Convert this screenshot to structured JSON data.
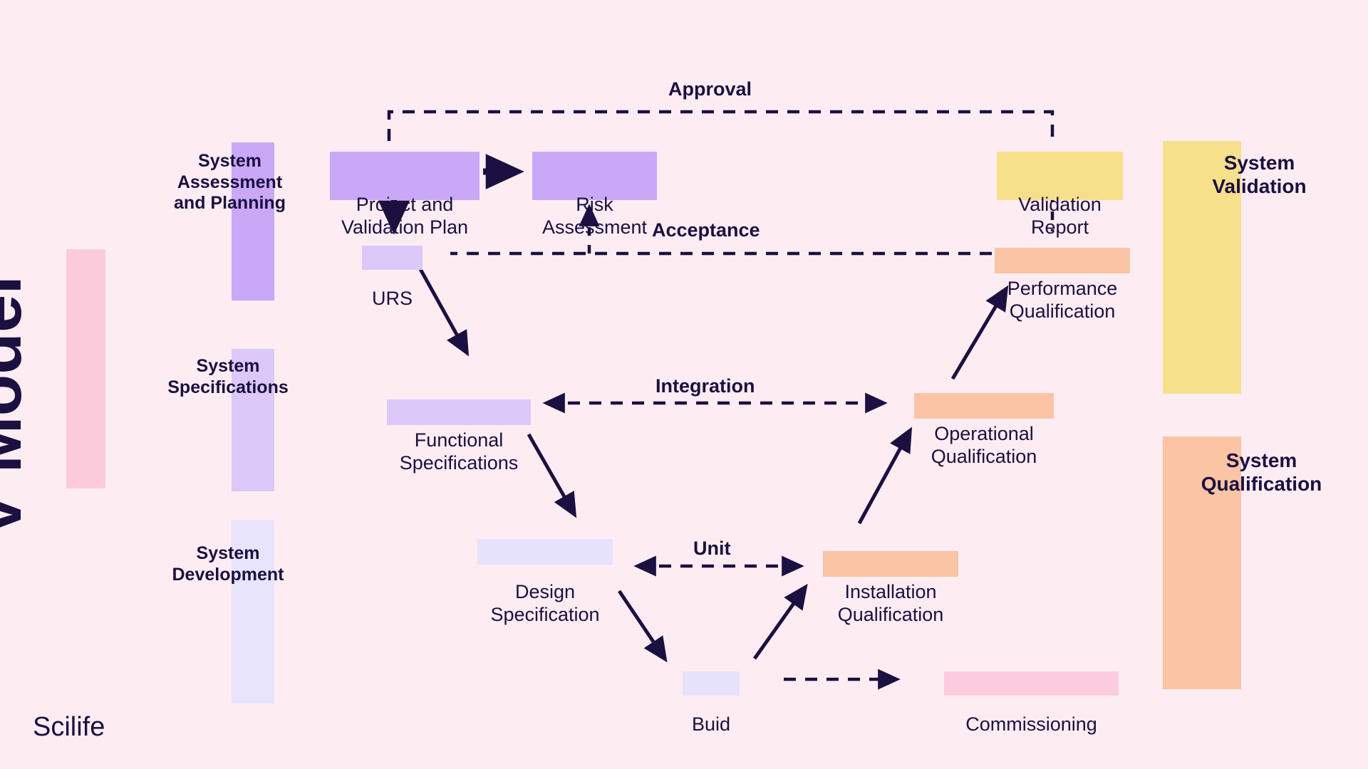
{
  "page": {
    "title": "V Model",
    "brand": "Scilife",
    "background_color": "#FDEDF2",
    "text_color": "#1B1040"
  },
  "colors": {
    "background": "#FDEDF2",
    "ink": "#1B1040",
    "purple_strong": "#C9A9F7",
    "purple_mid": "#DCC9FA",
    "purple_light": "#E6E2FC",
    "lavender_pale": "#E7E4FB",
    "yellow": "#F7E08B",
    "orange": "#FBC4A5",
    "pink": "#FBCCDE",
    "pink_band": "#FBCBDC"
  },
  "vertical_title": {
    "label": "V Model",
    "band_color": "#FBCBDC"
  },
  "left_captions": [
    {
      "label": "System\nAssessment\nand Planning",
      "band_color": "#C9A9F7"
    },
    {
      "label": "System\nSpecifications",
      "band_color": "#DCC9FA"
    },
    {
      "label": "System\nDevelopment",
      "band_color": "#E7E4FB"
    }
  ],
  "right_captions": [
    {
      "label": "System\nValidation",
      "band_color": "#F7E08B"
    },
    {
      "label": "System\nQualification",
      "band_color": "#FBC4A5"
    }
  ],
  "nodes": [
    {
      "id": "project-and-validation-plan",
      "label": "Project and\nValidation Plan",
      "highlight_color": "#C9A9F7"
    },
    {
      "id": "risk-assessment",
      "label": "Risk\nAssessment",
      "highlight_color": "#C9A9F7"
    },
    {
      "id": "urs",
      "label": "URS",
      "highlight_color": "#DCC9FA"
    },
    {
      "id": "validation-report",
      "label": "Validation\nReport",
      "highlight_color": "#F7E08B"
    },
    {
      "id": "performance-qualification",
      "label": "Performance\nQualification",
      "highlight_color": "#FBC4A5"
    },
    {
      "id": "functional-specifications",
      "label": "Functional\nSpecifications",
      "highlight_color": "#DCC9FA"
    },
    {
      "id": "operational-qualification",
      "label": "Operational\nQualification",
      "highlight_color": "#FBC4A5"
    },
    {
      "id": "design-specification",
      "label": "Design\nSpecification",
      "highlight_color": "#E6E2FC"
    },
    {
      "id": "installation-qualification",
      "label": "Installation\nQualification",
      "highlight_color": "#FBC4A5"
    },
    {
      "id": "buid",
      "label": "Buid",
      "highlight_color": "#E6E2FC"
    },
    {
      "id": "commissioning",
      "label": "Commissioning",
      "highlight_color": "#FBCCDE"
    }
  ],
  "flow_labels": [
    {
      "id": "approval",
      "label": "Approval"
    },
    {
      "id": "acceptance",
      "label": "Acceptance"
    },
    {
      "id": "integration",
      "label": "Integration"
    },
    {
      "id": "unit",
      "label": "Unit"
    }
  ]
}
